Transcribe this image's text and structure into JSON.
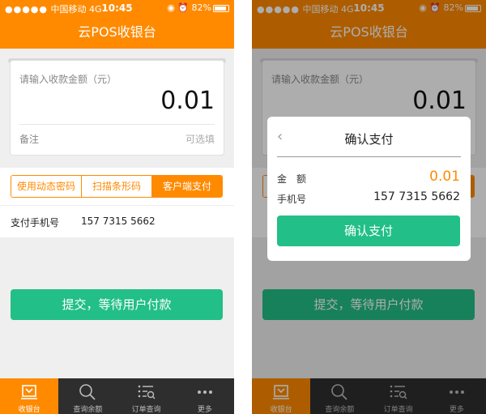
{
  "status": {
    "carrier": "中国移动",
    "network": "4G",
    "time": "10:45",
    "battery": "82%"
  },
  "app": {
    "title": "云POS收银台"
  },
  "amount": {
    "label": "请输入收款金额（元）",
    "value": "0.01",
    "note_label": "备注",
    "note_hint": "可选填"
  },
  "pay_tabs": [
    {
      "label": "使用动态密码",
      "active": false
    },
    {
      "label": "扫描条形码",
      "active": false
    },
    {
      "label": "客户端支付",
      "active": true
    }
  ],
  "phone": {
    "label": "支付手机号",
    "value": "157 7315 5662"
  },
  "submit": {
    "label": "提交，等待用户付款"
  },
  "tabbar": [
    {
      "label": "收银台",
      "icon": "register-icon"
    },
    {
      "label": "查询余额",
      "icon": "search-icon"
    },
    {
      "label": "订单查询",
      "icon": "order-list-icon"
    },
    {
      "label": "更多",
      "icon": "more-icon"
    }
  ],
  "dialog": {
    "title": "确认支付",
    "back_icon": "‹",
    "amount_label": "金　额",
    "amount_value": "0.01",
    "phone_label": "手机号",
    "phone_value": "157 7315 5662",
    "confirm_label": "确认支付"
  },
  "colors": {
    "accent": "#ff8a00",
    "primary_button": "#22bf88",
    "tabbar_bg": "#2e2e2e"
  }
}
